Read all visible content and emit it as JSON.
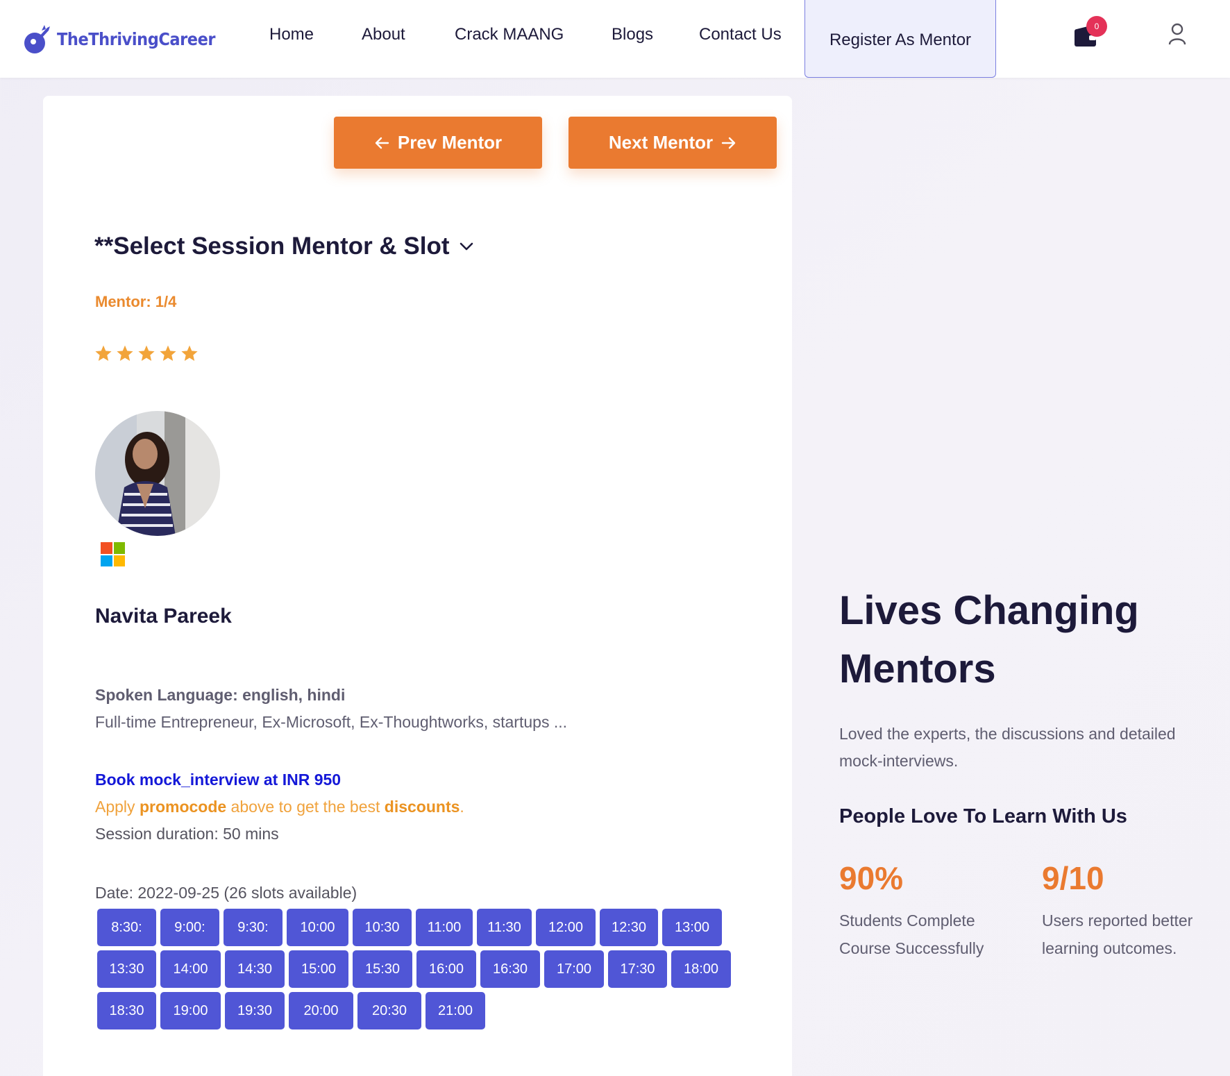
{
  "brand": {
    "name": "TheThrivingCareer",
    "color": "#4a4fc9"
  },
  "nav": {
    "items": [
      "Home",
      "About",
      "Crack MAANG",
      "Blogs",
      "Contact Us"
    ],
    "register": "Register As Mentor",
    "cart_count": "0"
  },
  "buttons": {
    "prev": "Prev Mentor",
    "next": "Next Mentor"
  },
  "session": {
    "title": "**Select Session Mentor & Slot",
    "mentor_count": "Mentor: 1/4",
    "rating_stars": 5
  },
  "mentor": {
    "name": "Navita Pareek",
    "languages": "Spoken Language: english, hindi",
    "bio": "Full-time Entrepreneur, Ex-Microsoft, Ex-Thoughtworks, startups ...",
    "company_icon": "microsoft-logo-icon"
  },
  "booking": {
    "book_text": "Book mock_interview at INR 950",
    "promo_pre": "Apply ",
    "promo_word": "promocode",
    "promo_mid": " above to get the best ",
    "promo_word2": "discounts",
    "promo_end": ".",
    "duration": "Session duration: 50 mins",
    "date": "Date: 2022-09-25 (26 slots available)",
    "slots": [
      [
        "8:30:",
        "9:00:",
        "9:30:",
        "10:00",
        "10:30",
        "11:00",
        "11:30",
        "12:00",
        "12:30",
        "13:00"
      ],
      [
        "13:30",
        "14:00",
        "14:30",
        "15:00",
        "15:30",
        "16:00",
        "16:30",
        "17:00",
        "17:30",
        "18:00"
      ],
      [
        "18:30",
        "19:00",
        "19:30",
        "20:00",
        "20:30",
        "21:00"
      ]
    ]
  },
  "right": {
    "title_line1": "Lives Changing",
    "title_line2": "Mentors",
    "subtitle": "Loved the experts, the discussions and detailed mock-interviews.",
    "heading": "People Love To Learn With Us",
    "stats": [
      {
        "value": "90%",
        "desc": "Students Complete Course Successfully"
      },
      {
        "value": "9/10",
        "desc": "Users reported better learning outcomes."
      }
    ]
  },
  "colors": {
    "accent_orange": "#ea7a30",
    "slot_blue": "#5056d6",
    "star": "#f2a43a"
  }
}
